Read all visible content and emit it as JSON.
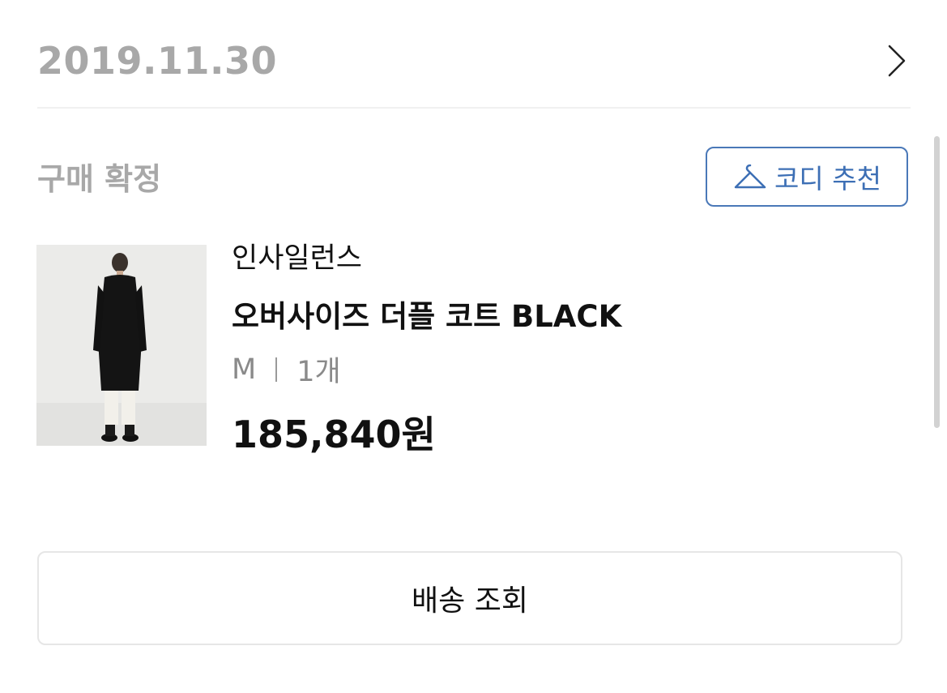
{
  "order": {
    "date": "2019.11.30",
    "chevron_icon": "chevron-right-icon"
  },
  "status": {
    "label": "구매 확정"
  },
  "codi_button": {
    "label": "코디 추천",
    "icon": "hanger-icon",
    "color": "#3d6fb5"
  },
  "product": {
    "image_icon": "product-photo",
    "brand": "인사일런스",
    "name": "오버사이즈 더플 코트 BLACK",
    "size": "M",
    "quantity": "1개",
    "price": "185,840원"
  },
  "delivery_button": {
    "label": "배송 조회"
  }
}
